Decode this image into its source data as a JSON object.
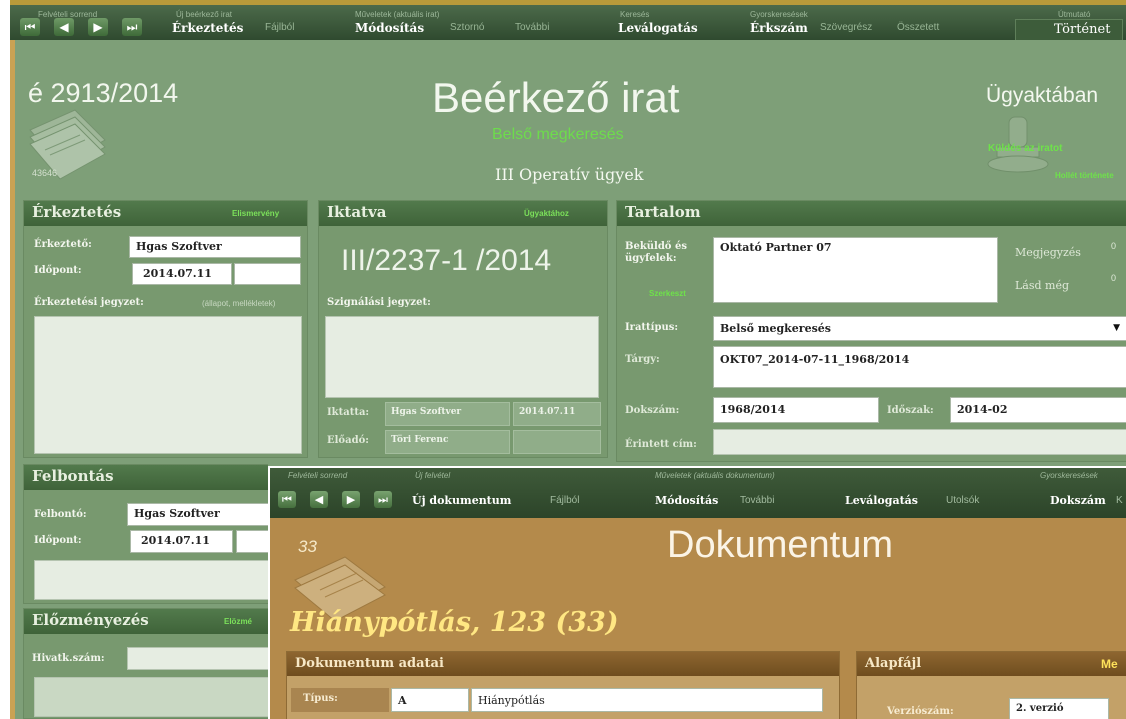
{
  "toolbar": {
    "groups": [
      "Felvételi sorrend",
      "Új beérkező irat",
      "Műveletek (aktuális irat)",
      "Keresés",
      "Gyorskeresések",
      "Útmutató"
    ],
    "buttons": {
      "erkeztetes": "Érkeztetés",
      "fajlbol": "Fájlból",
      "modositas": "Módosítás",
      "sztorno": "Sztornó",
      "tovabbi": "További",
      "levalogatas": "Leválogatás",
      "erkszam": "Érkszám",
      "szovegresz": "Szövegrész",
      "osszetett": "Összetett",
      "tortenet": "Történet"
    }
  },
  "header": {
    "reg_number": "é 2913/2014",
    "small_id": "43646",
    "title": "Beérkező irat",
    "subtitle": "Belső megkeresés",
    "department": "III Operatív ügyek",
    "status": "Ügyaktában",
    "link_send": "Küldés az iratot",
    "link_history": "Hollét története"
  },
  "erkeztetes": {
    "title": "Érkeztetés",
    "link": "Elismervény",
    "erkezteto_label": "Érkeztető:",
    "erkezteto_value": "Hgas Szoftver",
    "idopont_label": "Időpont:",
    "idopont_value": "2014.07.11",
    "jegyzet_label": "Érkeztetési jegyzet:",
    "jegyzet_hint": "(állapot, mellékletek)"
  },
  "iktatva": {
    "title": "Iktatva",
    "link": "Ügyaktához",
    "number": "III/2237-1 /2014",
    "szignalasi_label": "Szignálási jegyzet:",
    "iktatta_label": "Iktatta:",
    "iktatta_value": "Hgas Szoftver",
    "iktatta_date": "2014.07.11",
    "eloado_label": "Előadó:",
    "eloado_value": "Töri Ferenc"
  },
  "tartalom": {
    "title": "Tartalom",
    "bekuldo_label": "Beküldő és ügyfelek:",
    "bekuldo_value": "Oktató Partner 07",
    "szerkeszt": "Szerkeszt",
    "megjegyzes": "Megjegyzés",
    "lasd_meg": "Lásd még",
    "megjegyzes_count": "0",
    "lasd_meg_count": "0",
    "irattipus_label": "Irattípus:",
    "irattipus_value": "Belső megkeresés",
    "targy_label": "Tárgy:",
    "targy_value": "OKT07_2014-07-11_1968/2014",
    "dokszam_label": "Dokszám:",
    "dokszam_value": "1968/2014",
    "idoszak_label": "Időszak:",
    "idoszak_value": "2014-02",
    "erintett_label": "Érintett cím:"
  },
  "felbontas": {
    "title": "Felbontás",
    "felbonto_label": "Felbontó:",
    "felbonto_value": "Hgas Szoftver",
    "idopont_label": "Időpont:",
    "idopont_value": "2014.07.11"
  },
  "elozmenyezes": {
    "title": "Előzményezés",
    "link": "Elözmé",
    "hivatk_label": "Hivatk.szám:"
  },
  "doc_toolbar": {
    "groups": [
      "Felvételi sorrend",
      "Új felvétel",
      "Műveletek (aktuális dokumentum)",
      "Gyorskeresések"
    ],
    "buttons": {
      "uj_dokumentum": "Új dokumentum",
      "fajlbol": "Fájlból",
      "modositas": "Módosítás",
      "tovabbi": "További",
      "levalogatas": "Leválogatás",
      "utolsok": "Utolsók",
      "dokszam": "Dokszám",
      "k": "K"
    }
  },
  "document": {
    "number": "33",
    "title": "Dokumentum",
    "heading": "Hiánypótlás, 123 (33)",
    "adatai_title": "Dokumentum adatai",
    "tipus_label": "Típus:",
    "tipus_code": "A",
    "tipus_value": "Hiánypótlás",
    "alapfajl_title": "Alapfájl",
    "alapfajl_link": "Me",
    "verzioszam_label": "Verziószám:",
    "verzioszam_value": "2. verzió"
  }
}
